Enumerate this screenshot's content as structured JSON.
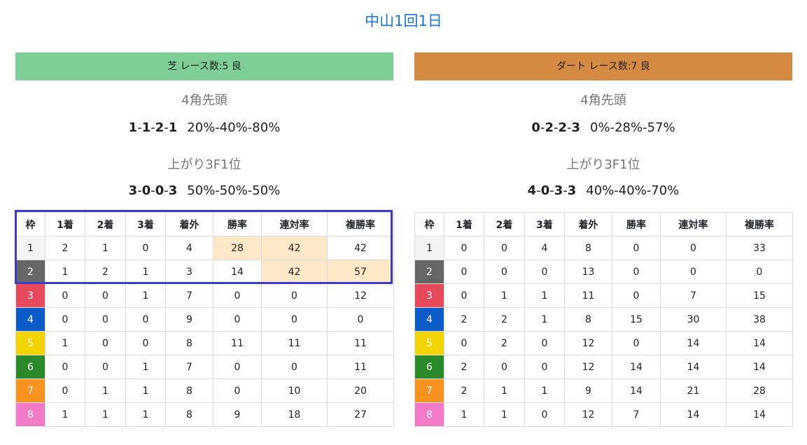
{
  "page_title": "中山1回1日",
  "panels": [
    {
      "header": "芝 レース数:5 良",
      "header_color": "#7dcf97",
      "stat1": {
        "label": "4角先頭",
        "n1": "1",
        "n2": "1",
        "n3": "2",
        "n4": "1",
        "pct": "20%-40%-80%"
      },
      "stat2": {
        "label": "上がり3F1位",
        "n1": "3",
        "n2": "0",
        "n3": "0",
        "n4": "3",
        "pct": "50%-50%-50%"
      }
    },
    {
      "header": "ダート レース数:7 良",
      "header_color": "#d58a42",
      "stat1": {
        "label": "4角先頭",
        "n1": "0",
        "n2": "2",
        "n3": "2",
        "n4": "3",
        "pct": "0%-28%-57%"
      },
      "stat2": {
        "label": "上がり3F1位",
        "n1": "4",
        "n2": "0",
        "n3": "3",
        "n4": "3",
        "pct": "40%-40%-70%"
      }
    }
  ],
  "table_headers": [
    "枠",
    "1着",
    "2着",
    "3着",
    "着外",
    "勝率",
    "連対率",
    "複勝率"
  ],
  "waku_colors": [
    "#f4f4f4",
    "#666666",
    "#e8495a",
    "#0b5bc9",
    "#f2d500",
    "#2a8a2a",
    "#f7931e",
    "#f27ac8"
  ],
  "tables": [
    {
      "rows": [
        [
          "1",
          "2",
          "1",
          "0",
          "4",
          "28",
          "42",
          "42"
        ],
        [
          "2",
          "1",
          "2",
          "1",
          "3",
          "14",
          "42",
          "57"
        ],
        [
          "3",
          "0",
          "0",
          "1",
          "7",
          "0",
          "0",
          "12"
        ],
        [
          "4",
          "0",
          "0",
          "0",
          "9",
          "0",
          "0",
          "0"
        ],
        [
          "5",
          "1",
          "0",
          "0",
          "8",
          "11",
          "11",
          "11"
        ],
        [
          "6",
          "0",
          "0",
          "1",
          "7",
          "0",
          "0",
          "11"
        ],
        [
          "7",
          "0",
          "1",
          "1",
          "8",
          "0",
          "10",
          "20"
        ],
        [
          "8",
          "1",
          "1",
          "1",
          "8",
          "9",
          "18",
          "27"
        ]
      ],
      "highlight_cells": [
        [
          0,
          5
        ],
        [
          0,
          6
        ],
        [
          1,
          6
        ],
        [
          1,
          7
        ]
      ]
    },
    {
      "rows": [
        [
          "1",
          "0",
          "0",
          "4",
          "8",
          "0",
          "0",
          "33"
        ],
        [
          "2",
          "0",
          "0",
          "0",
          "13",
          "0",
          "0",
          "0"
        ],
        [
          "3",
          "0",
          "1",
          "1",
          "11",
          "0",
          "7",
          "15"
        ],
        [
          "4",
          "2",
          "2",
          "1",
          "8",
          "15",
          "30",
          "38"
        ],
        [
          "5",
          "0",
          "2",
          "0",
          "12",
          "0",
          "14",
          "14"
        ],
        [
          "6",
          "2",
          "0",
          "0",
          "12",
          "14",
          "14",
          "14"
        ],
        [
          "7",
          "2",
          "1",
          "1",
          "9",
          "14",
          "21",
          "28"
        ],
        [
          "8",
          "1",
          "1",
          "0",
          "12",
          "7",
          "14",
          "14"
        ]
      ],
      "highlight_cells": []
    }
  ]
}
